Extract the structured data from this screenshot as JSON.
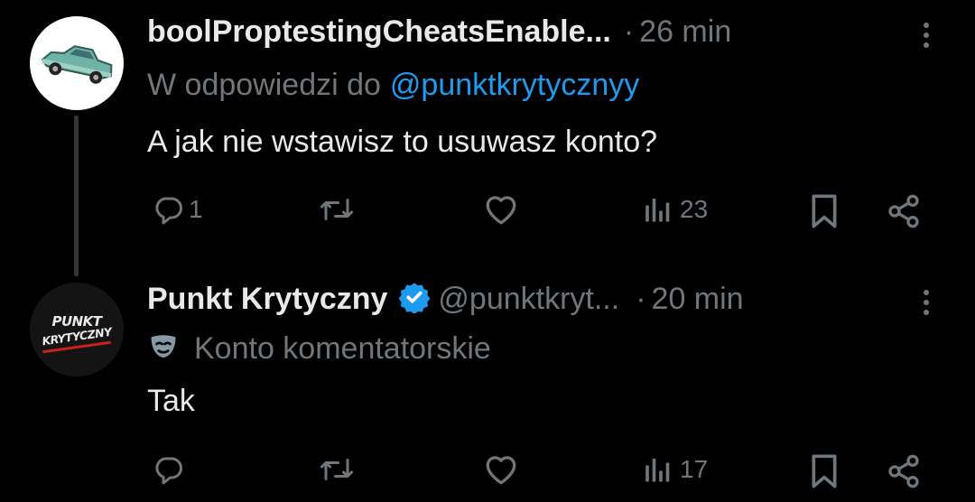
{
  "tweets": [
    {
      "author": "boolProptestingCheatsEnable...",
      "separator": "·",
      "time": "26 min",
      "reply_prefix": "W odpowiedzi do",
      "reply_to": "@punktkrytycznyy",
      "text": "A jak nie wstawisz to usuwasz konto?",
      "replies": "1",
      "views": "23"
    },
    {
      "author": "Punkt Krytyczny",
      "verified": true,
      "handle": "@punktkryt...",
      "separator": "·",
      "time": "20 min",
      "account_type": "Konto komentatorskie",
      "avatar_text_line1": "PUNKT",
      "avatar_text_line2": "KRYTYCZNY",
      "text": "Tak",
      "replies": "",
      "views": "17"
    }
  ],
  "colors": {
    "background": "#000000",
    "text": "#e7e9ea",
    "muted": "#71767b",
    "link": "#1d9bf0",
    "verified": "#1d9bf0"
  },
  "icons": [
    "reply-icon",
    "retweet-icon",
    "like-icon",
    "views-icon",
    "bookmark-icon",
    "share-icon",
    "more-icon",
    "verified-badge-icon",
    "mask-icon"
  ]
}
